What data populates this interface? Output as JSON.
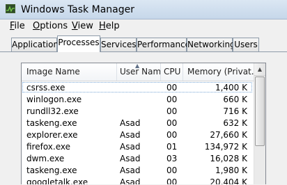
{
  "window": {
    "title": "Windows Task Manager"
  },
  "menu": [
    {
      "label": "ile",
      "mnemonic": "F"
    },
    {
      "label": "ptions",
      "mnemonic": "O"
    },
    {
      "label": "iew",
      "mnemonic": "V"
    },
    {
      "label": "elp",
      "mnemonic": "H"
    }
  ],
  "tabs": [
    {
      "label": "Applications"
    },
    {
      "label": "Processes",
      "active": true
    },
    {
      "label": "Services"
    },
    {
      "label": "Performance"
    },
    {
      "label": "Networking"
    },
    {
      "label": "Users"
    }
  ],
  "columns": {
    "image_name": "Image Name",
    "user_name": "User Name",
    "cpu": "CPU",
    "memory": "Memory (Privat..."
  },
  "processes": [
    {
      "image": "csrss.exe",
      "user": "",
      "cpu": "00",
      "mem": "1,400 K",
      "selected": true
    },
    {
      "image": "winlogon.exe",
      "user": "",
      "cpu": "00",
      "mem": "660 K"
    },
    {
      "image": "rundll32.exe",
      "user": "",
      "cpu": "00",
      "mem": "716 K"
    },
    {
      "image": "taskeng.exe",
      "user": "Asad",
      "cpu": "00",
      "mem": "632 K"
    },
    {
      "image": "explorer.exe",
      "user": "Asad",
      "cpu": "00",
      "mem": "27,660 K"
    },
    {
      "image": "firefox.exe",
      "user": "Asad",
      "cpu": "01",
      "mem": "134,972 K"
    },
    {
      "image": "dwm.exe",
      "user": "Asad",
      "cpu": "03",
      "mem": "16,028 K"
    },
    {
      "image": "taskeng.exe",
      "user": "Asad",
      "cpu": "00",
      "mem": "1,980 K"
    },
    {
      "image": "googletalk.exe",
      "user": "Asad",
      "cpu": "00",
      "mem": "20,404 K"
    }
  ]
}
